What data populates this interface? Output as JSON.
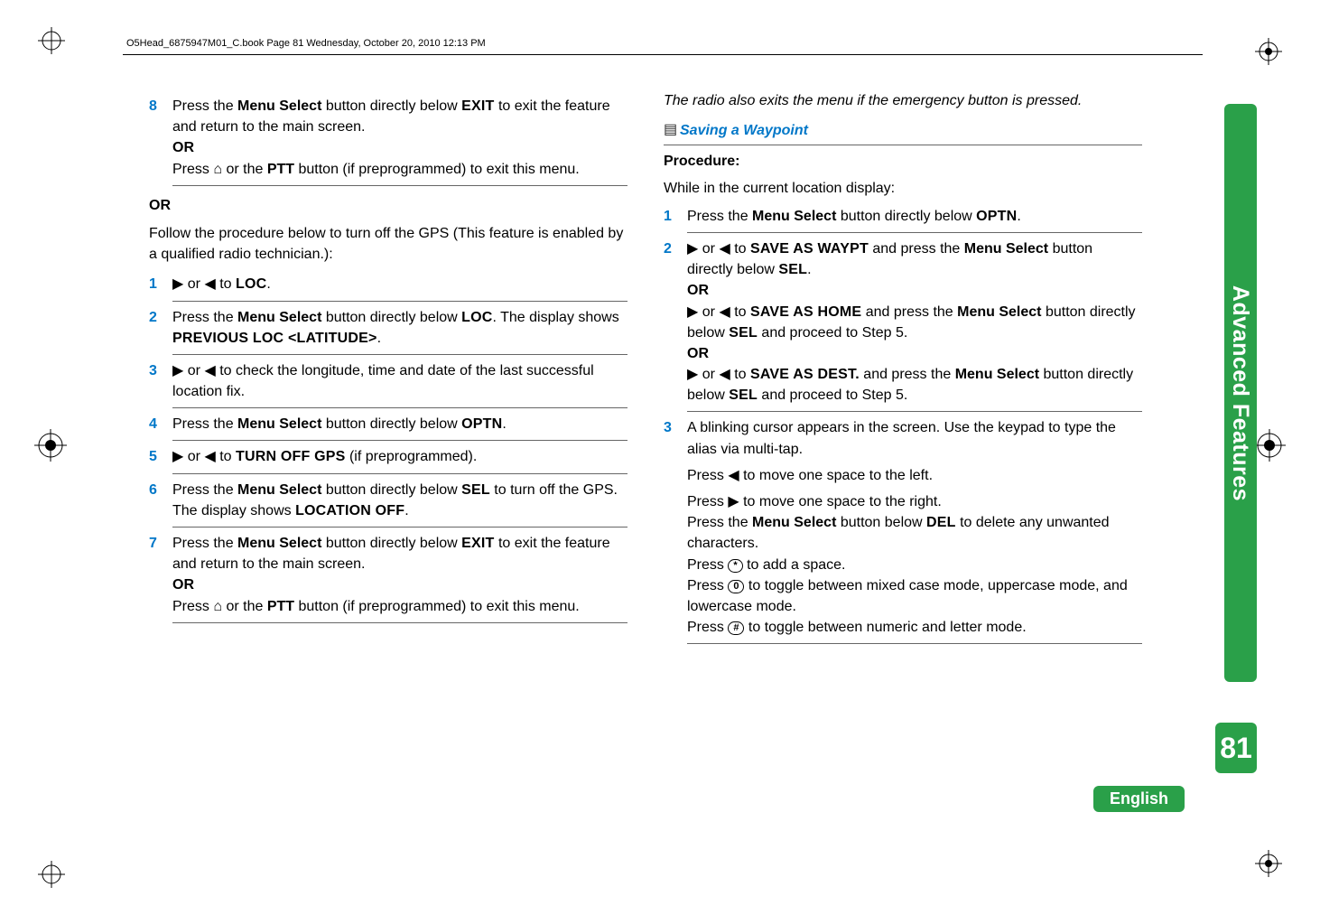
{
  "header": "O5Head_6875947M01_C.book  Page 81  Wednesday, October 20, 2010  12:13 PM",
  "sidebar": "Advanced Features",
  "pageNumber": "81",
  "langLabel": "English",
  "symbols": {
    "triRight": "▶",
    "triLeft": "◀",
    "home": "⌂",
    "star": "*",
    "zero": "0",
    "hash": "#"
  },
  "left": {
    "s8a": "Press the ",
    "menuSelect": "Menu Select",
    "s8b": " button directly below ",
    "exit": "EXIT",
    "s8c": " to exit the feature and return to the main screen.",
    "or": "OR",
    "s8d": "Press ",
    "s8e": " or the ",
    "ptt": "PTT",
    "s8f": " button (if preprogrammed) to exit this menu.",
    "orLead": "OR",
    "intro": "Follow the procedure below to turn off the GPS (This feature is enabled by a qualified radio technician.):",
    "s1a": " or ",
    "s1b": " to ",
    "loc": "LOC",
    "s1c": ".",
    "s2a": "Press the ",
    "s2b": " button directly below ",
    "s2c": ". The display shows ",
    "prevLoc": "PREVIOUS LOC <LATITUDE>",
    "s2d": ".",
    "s3a": " or ",
    "s3b": " to check the longitude, time and date of the last successful location fix.",
    "s4a": "Press the ",
    "s4b": " button directly below ",
    "optn": "OPTN",
    "s4c": ".",
    "s5a": " or ",
    "s5b": " to ",
    "turnOffGps": "TURN OFF GPS",
    "s5c": " (if preprogrammed).",
    "s6a": "Press the ",
    "s6b": " button directly below ",
    "sel": "SEL",
    "s6c": " to turn off the GPS. The display shows ",
    "locOff": "LOCATION OFF",
    "s6d": ".",
    "s7a": "Press the ",
    "s7b": " button directly below ",
    "s7c": " to exit the feature and return to the main screen.",
    "s7d": "Press ",
    "s7e": " or the ",
    "s7f": " button (if preprogrammed) to exit this menu."
  },
  "right": {
    "note": "The radio also exits the menu if the emergency button is pressed.",
    "sectionTitle": "Saving a Waypoint",
    "procedure": "Procedure:",
    "while": "While in the current location display:",
    "s1a": "Press the ",
    "menuSelect": "Menu Select",
    "s1b": " button directly below ",
    "optn": "OPTN",
    "s1c": ".",
    "s2a": " or ",
    "s2b": " to ",
    "saveWaypt": "SAVE AS WAYPT",
    "s2c": " and press the ",
    "s2d": " button directly below ",
    "sel": "SEL",
    "s2e": ".",
    "or": "OR",
    "s2f": " or ",
    "s2g": " to ",
    "saveHome": "SAVE AS HOME",
    "s2h": " and press the ",
    "s2i": " button directly below ",
    "s2j": " and proceed to Step 5.",
    "s2k": " or ",
    "s2l": " to ",
    "saveDest": "SAVE AS DEST.",
    "s2m": " and press the ",
    "s2n": " button directly below ",
    "s2o": " and proceed to Step 5.",
    "s3a": "A blinking cursor appears in the screen. Use the keypad to type the alias via multi-tap.",
    "s3b": "Press ",
    "s3c": " to move one space to the left.",
    "s3d": "Press ",
    "s3e": " to move one space to the right.",
    "s3f": "Press the ",
    "s3g": " button below ",
    "del": "DEL",
    "s3h": " to delete any unwanted characters.",
    "s3i": "Press ",
    "s3j": " to add a space.",
    "s3k": "Press ",
    "s3l": " to toggle between mixed case mode, uppercase mode, and lowercase mode.",
    "s3m": "Press ",
    "s3n": " to toggle between numeric and letter mode."
  }
}
